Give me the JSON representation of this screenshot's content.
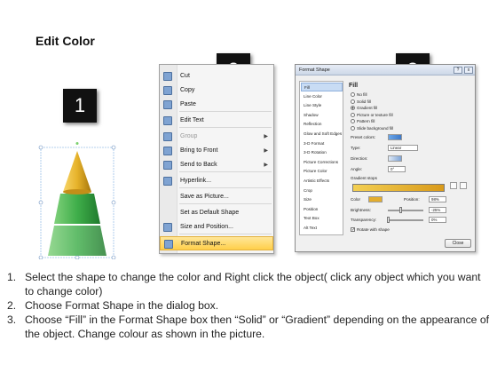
{
  "page": {
    "title": "Edit Color"
  },
  "steps": [
    "1",
    "2",
    "3"
  ],
  "context_menu": {
    "items": [
      {
        "label": "Cut",
        "icon": "scissors-icon",
        "submenu": false,
        "disabled": false
      },
      {
        "label": "Copy",
        "icon": "copy-icon",
        "submenu": false,
        "disabled": false
      },
      {
        "label": "Paste",
        "icon": "paste-icon",
        "submenu": false,
        "disabled": false
      },
      {
        "label": "Edit Text",
        "icon": "edit-text-icon",
        "submenu": false,
        "disabled": false
      },
      {
        "label": "Group",
        "icon": "group-icon",
        "submenu": true,
        "disabled": true
      },
      {
        "label": "Bring to Front",
        "icon": "bring-front-icon",
        "submenu": true,
        "disabled": false
      },
      {
        "label": "Send to Back",
        "icon": "send-back-icon",
        "submenu": true,
        "disabled": false
      },
      {
        "label": "Hyperlink...",
        "icon": "hyperlink-icon",
        "submenu": false,
        "disabled": false
      },
      {
        "label": "Save as Picture...",
        "icon": "",
        "submenu": false,
        "disabled": false
      },
      {
        "label": "Set as Default Shape",
        "icon": "",
        "submenu": false,
        "disabled": false
      },
      {
        "label": "Size and Position...",
        "icon": "size-position-icon",
        "submenu": false,
        "disabled": false
      },
      {
        "label": "Format Shape...",
        "icon": "format-shape-icon",
        "submenu": false,
        "disabled": false,
        "selected": true
      }
    ]
  },
  "dialog": {
    "title": "Format Shape",
    "help": "?",
    "close_x": "x",
    "nav": [
      "Fill",
      "Line Color",
      "Line Style",
      "Shadow",
      "Reflection",
      "Glow and Soft Edges",
      "3-D Format",
      "3-D Rotation",
      "Picture Corrections",
      "Picture Color",
      "Artistic Effects",
      "Crop",
      "Size",
      "Position",
      "Text Box",
      "Alt Text"
    ],
    "fill_heading": "Fill",
    "fill_options": [
      "No fill",
      "Solid fill",
      "Gradient fill",
      "Picture or texture fill",
      "Pattern fill",
      "Slide background fill"
    ],
    "fill_selected": "Gradient fill",
    "preset_label": "Preset colors:",
    "type_label": "Type:",
    "type_value": "Linear",
    "direction_label": "Direction:",
    "angle_label": "Angle:",
    "angle_value": "0°",
    "stops_label": "Gradient stops",
    "color_label": "Color",
    "position_label": "Position:",
    "position_value": "98%",
    "brightness_label": "Brightness:",
    "brightness_value": "-25%",
    "transparency_label": "Transparency:",
    "transparency_value": "0%",
    "rotate_label": "Rotate with shape",
    "close_label": "Close"
  },
  "instructions": [
    {
      "num": "1.",
      "text": "Select the shape to change the color and Right click the object( click any object which you want to change color)"
    },
    {
      "num": "2.",
      "text": "Choose Format Shape in the dialog box."
    },
    {
      "num": "3.",
      "text": "Choose “Fill” in the Format Shape box then “Solid” or “Gradient” depending on the appearance of the object. Change colour as shown in the picture."
    }
  ],
  "colors": {
    "cone_gold": "#e6b22a",
    "pyramid_green": "#3fae4a",
    "menu_highlight": "#ffd566",
    "gradient_start": "#f3cf52",
    "gradient_end": "#d99a1a"
  }
}
